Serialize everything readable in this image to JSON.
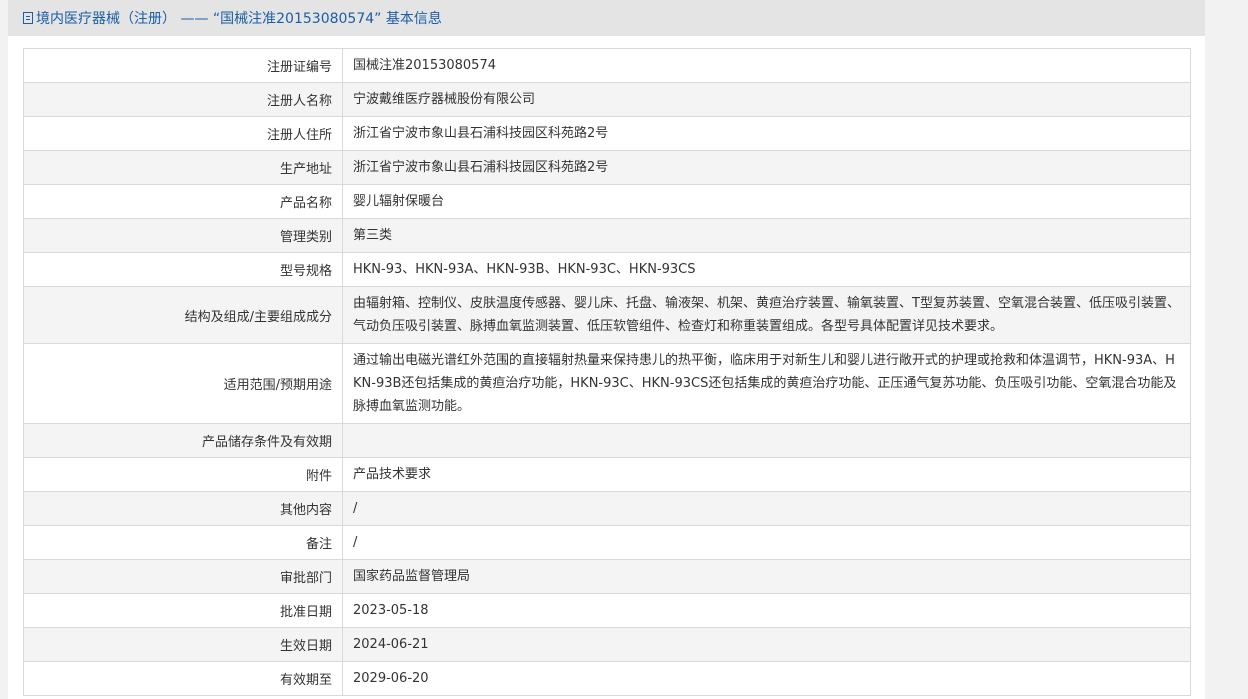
{
  "header": {
    "title": "境内医疗器械（注册） ——  “国械注准20153080574” 基本信息"
  },
  "rows": [
    {
      "label": "注册证编号",
      "value": "国械注准20153080574"
    },
    {
      "label": "注册人名称",
      "value": "宁波戴维医疗器械股份有限公司"
    },
    {
      "label": "注册人住所",
      "value": "浙江省宁波市象山县石浦科技园区科苑路2号"
    },
    {
      "label": "生产地址",
      "value": "浙江省宁波市象山县石浦科技园区科苑路2号"
    },
    {
      "label": "产品名称",
      "value": "婴儿辐射保暖台"
    },
    {
      "label": "管理类别",
      "value": "第三类"
    },
    {
      "label": "型号规格",
      "value": "HKN-93、HKN-93A、HKN-93B、HKN-93C、HKN-93CS"
    },
    {
      "label": "结构及组成/主要组成成分",
      "value": "由辐射箱、控制仪、皮肤温度传感器、婴儿床、托盘、输液架、机架、黄疸治疗装置、输氧装置、T型复苏装置、空氧混合装置、低压吸引装置、气动负压吸引装置、脉搏血氧监测装置、低压软管组件、检查灯和称重装置组成。各型号具体配置详见技术要求。"
    },
    {
      "label": "适用范围/预期用途",
      "value": "通过输出电磁光谱红外范围的直接辐射热量来保持患儿的热平衡，临床用于对新生儿和婴儿进行敞开式的护理或抢救和体温调节，HKN-93A、HKN-93B还包括集成的黄疸治疗功能，HKN-93C、HKN-93CS还包括集成的黄疸治疗功能、正压通气复苏功能、负压吸引功能、空氧混合功能及脉搏血氧监测功能。"
    },
    {
      "label": "产品储存条件及有效期",
      "value": ""
    },
    {
      "label": "附件",
      "value": "产品技术要求"
    },
    {
      "label": "其他内容",
      "value": "/"
    },
    {
      "label": "备注",
      "value": "/"
    },
    {
      "label": "审批部门",
      "value": "国家药品监督管理局"
    },
    {
      "label": "批准日期",
      "value": "2023-05-18"
    },
    {
      "label": "生效日期",
      "value": "2024-06-21"
    },
    {
      "label": "有效期至",
      "value": "2029-06-20"
    }
  ]
}
